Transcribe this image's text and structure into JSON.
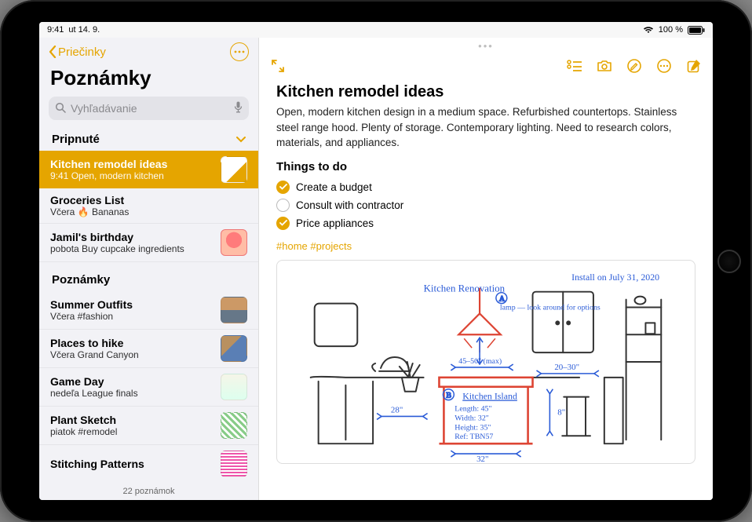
{
  "status": {
    "time": "9:41",
    "date": "ut 14. 9.",
    "battery": "100 %"
  },
  "sidebar": {
    "back_label": "Priečinky",
    "title": "Poznámky",
    "search_placeholder": "Vyhľadávanie",
    "pinned_header": "Pripnuté",
    "notes_header": "Poznámky",
    "footer": "22 poznámok",
    "pinned": [
      {
        "title": "Kitchen remodel ideas",
        "subtitle": "9:41  Open, modern kitchen"
      },
      {
        "title": "Groceries List",
        "subtitle": "Včera 🔥 Bananas"
      },
      {
        "title": "Jamil's birthday",
        "subtitle": "pobota Buy cupcake ingredients"
      }
    ],
    "notes": [
      {
        "title": "Summer Outfits",
        "subtitle": "Včera #fashion"
      },
      {
        "title": "Places to hike",
        "subtitle": "Včera Grand Canyon"
      },
      {
        "title": "Game Day",
        "subtitle": "nedeľa League finals"
      },
      {
        "title": "Plant Sketch",
        "subtitle": "piatok #remodel"
      },
      {
        "title": "Stitching Patterns",
        "subtitle": ""
      }
    ]
  },
  "note": {
    "title": "Kitchen remodel ideas",
    "body": "Open, modern kitchen design in a medium space. Refurbished countertops. Stainless steel range hood. Plenty of storage. Contemporary lighting. Need to research colors, materials, and appliances.",
    "todo_header": "Things to do",
    "tasks": [
      {
        "label": "Create a budget",
        "done": true
      },
      {
        "label": "Consult with contractor",
        "done": false
      },
      {
        "label": "Price appliances",
        "done": true
      }
    ],
    "tags": "#home #projects",
    "drawing": {
      "title_text": "Kitchen Renovation",
      "install_text": "Install on July 31, 2020",
      "lamp_note": "lamp — look around for options",
      "width_note": "45–50\" (max)",
      "island_label": "Kitchen Island",
      "island_specs": "Length: 45\"\nWidth: 32\"\nHeight: 35\"\nRef: TBN57",
      "dim_left": "28\"",
      "dim_bar": "8\"",
      "dim_right": "20–30\"",
      "dim_bottom": "32\"",
      "marker_a": "A",
      "marker_b": "B"
    }
  }
}
